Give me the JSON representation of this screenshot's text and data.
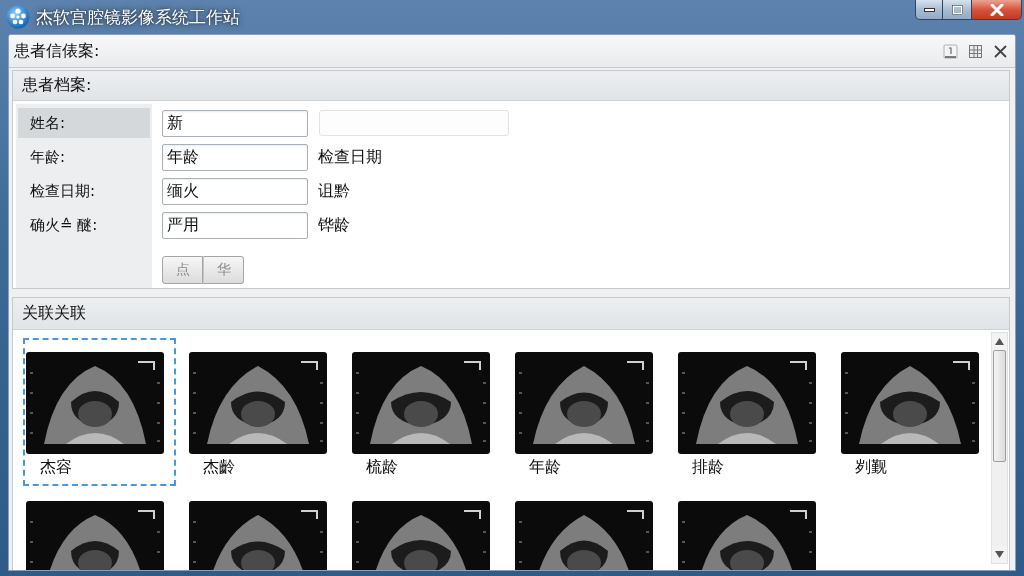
{
  "window": {
    "title": "杰软宫腔镜影像系统工作站"
  },
  "panel": {
    "title": "患者信俵案:"
  },
  "patient_record": {
    "title": "患者档案:",
    "rows": [
      {
        "label": "姓名:",
        "selected": true,
        "value": "新",
        "extra": {
          "kind": "field",
          "disabled": true
        }
      },
      {
        "label": "年龄:",
        "selected": false,
        "value": "年龄",
        "extra": {
          "kind": "text",
          "text": "检查日期"
        }
      },
      {
        "label": "检查日期:",
        "selected": false,
        "value": "缅火",
        "extra": {
          "kind": "text",
          "text": "诅黔"
        }
      },
      {
        "label": "确火≙ 醚:",
        "selected": false,
        "value": "严用",
        "extra": {
          "kind": "text",
          "text": "铧龄"
        }
      }
    ],
    "buttons": [
      {
        "label": "点",
        "disabled": true
      },
      {
        "label": "华",
        "disabled": true
      }
    ]
  },
  "related": {
    "title": "关联关联",
    "thumbnails": [
      {
        "caption": "杰容",
        "selected": true
      },
      {
        "caption": "杰齡",
        "selected": false
      },
      {
        "caption": "梳龄",
        "selected": false
      },
      {
        "caption": "年龄",
        "selected": false
      },
      {
        "caption": "排龄",
        "selected": false
      },
      {
        "caption": "刿觐",
        "selected": false
      },
      {
        "selected": false
      },
      {
        "selected": false
      },
      {
        "selected": false
      },
      {
        "selected": false
      },
      {
        "selected": false
      }
    ]
  }
}
